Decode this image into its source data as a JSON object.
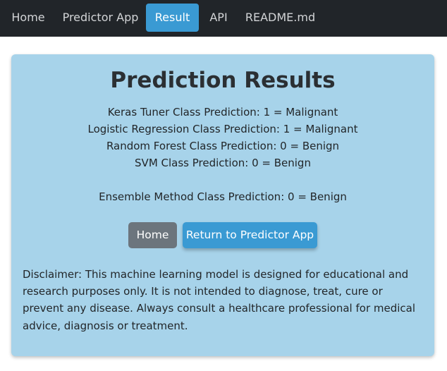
{
  "nav": {
    "items": [
      {
        "label": "Home",
        "active": false
      },
      {
        "label": "Predictor App",
        "active": false
      },
      {
        "label": "Result",
        "active": true
      },
      {
        "label": "API",
        "active": false
      },
      {
        "label": "README.md",
        "active": false
      }
    ]
  },
  "card": {
    "title": "Prediction Results",
    "predictions": [
      "Keras Tuner Class Prediction: 1 = Malignant",
      "Logistic Regression Class Prediction: 1 = Malignant",
      "Random Forest Class Prediction: 0 = Benign",
      "SVM Class Prediction: 0 = Benign"
    ],
    "ensemble": "Ensemble Method Class Prediction: 0 = Benign",
    "buttons": {
      "home_label": "Home",
      "return_label": "Return to Predictor App"
    },
    "disclaimer": "Disclaimer: This machine learning model is designed for educational and research purposes only. It is not intended to diagnose, treat, cure or prevent any disease. Always consult a healthcare professional for medical advice, diagnosis or treatment."
  },
  "colors": {
    "navbar_bg": "#212529",
    "accent": "#3a9ad3",
    "card_bg": "#a7d3ea",
    "secondary_button": "#6c757d"
  }
}
